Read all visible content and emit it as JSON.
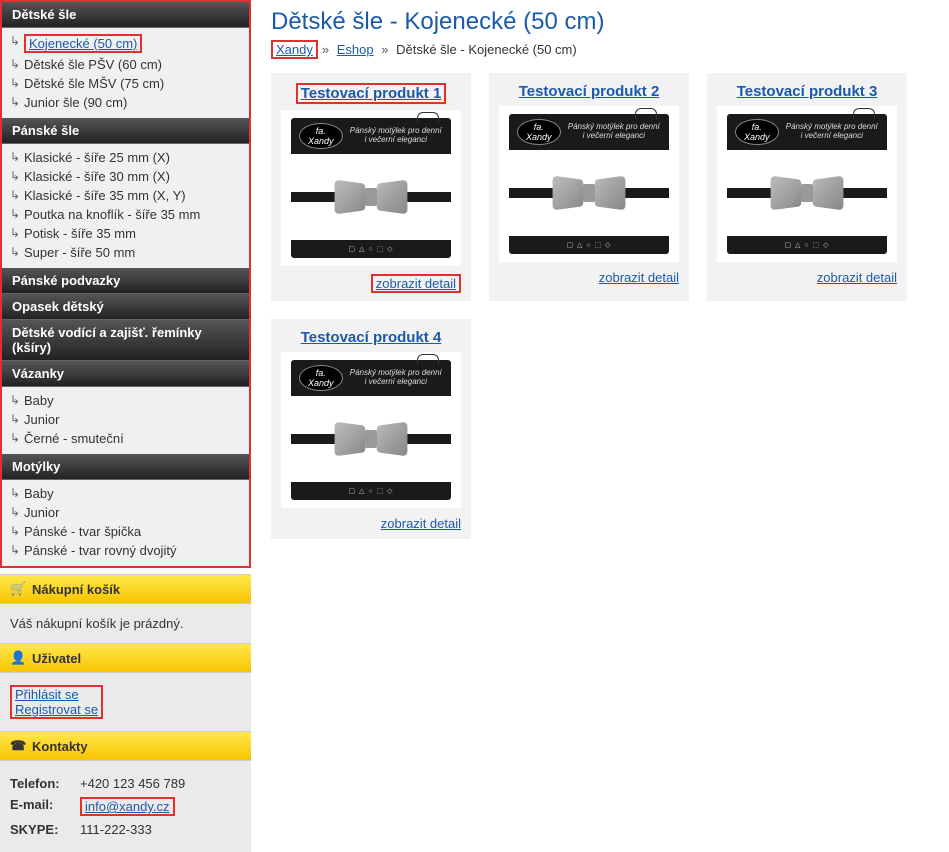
{
  "page": {
    "title": "Dětské šle - Kojenecké (50 cm)"
  },
  "breadcrumb": {
    "home": "Xandy",
    "sep": "»",
    "eshop": "Eshop",
    "current": "Dětské šle - Kojenecké (50 cm)"
  },
  "sidebar": {
    "cat1": {
      "header": "Dětské šle",
      "i0": "Kojenecké (50 cm)",
      "i1": "Dětské šle PŠV (60 cm)",
      "i2": "Dětské šle MŠV (75 cm)",
      "i3": "Junior šle (90 cm)"
    },
    "cat2": {
      "header": "Pánské šle",
      "i0": "Klasické - šíře 25 mm (X)",
      "i1": "Klasické - šíře 30 mm (X)",
      "i2": "Klasické - šíře 35 mm (X, Y)",
      "i3": "Poutka na knoflík - šíře 35 mm",
      "i4": "Potisk - šíře 35 mm",
      "i5": "Super - šíře 50 mm"
    },
    "cat3": {
      "header": "Pánské podvazky"
    },
    "cat4": {
      "header": "Opasek dětský"
    },
    "cat5": {
      "header": "Dětské vodící a zajišť. řemínky (kšíry)"
    },
    "cat6": {
      "header": "Vázanky",
      "i0": "Baby",
      "i1": "Junior",
      "i2": "Černé - smuteční"
    },
    "cat7": {
      "header": "Motýlky",
      "i0": "Baby",
      "i1": "Junior",
      "i2": "Pánské - tvar špička",
      "i3": "Pánské - tvar rovný dvojitý"
    }
  },
  "cart": {
    "header": "Nákupní košík",
    "empty": "Váš nákupní košík je prázdný."
  },
  "user": {
    "header": "Uživatel",
    "login": "Přihlásit se",
    "register": "Registrovat se"
  },
  "contacts": {
    "header": "Kontakty",
    "phone_label": "Telefon:",
    "phone": "+420 123 456 789",
    "email_label": "E-mail:",
    "email": "info@xandy.cz",
    "skype_label": "SKYPE:",
    "skype": "111-222-333"
  },
  "products": {
    "detail_label": "zobrazit detail",
    "p1": "Testovací produkt 1",
    "p2": "Testovací produkt 2",
    "p3": "Testovací produkt 3",
    "p4": "Testovací produkt 4",
    "img": {
      "brand": "fa. Xandy",
      "tagline": "Pánský motýlek pro denní i večerní eleganci",
      "symbols": "▢ △ ○ ⬚ ◇"
    }
  }
}
